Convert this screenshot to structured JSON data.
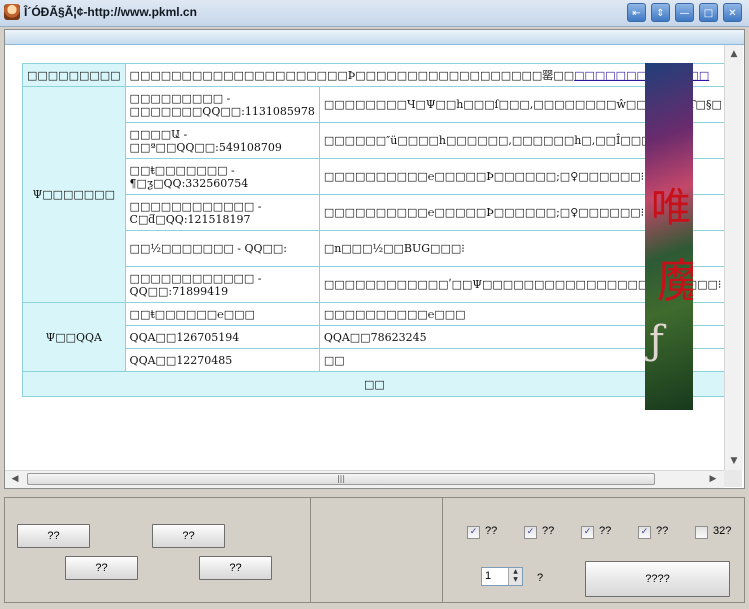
{
  "window": {
    "title": "Î´ÓÐÃ§Ã¦¢-http://www.pkml.cn"
  },
  "table": {
    "row1": {
      "label": "□□□□□□□□□",
      "text": "□□□□□□□□□□□□□□□□□□□□□Þ□□□□□□□□□□□□□□□□□□罂□□",
      "link": "□□□□□□□□□□□□□"
    },
    "group1_label": "Ψ□□□□□□□",
    "staff": [
      {
        "name": "□□□□□□□□□ -\n□□□□□□□QQ□□:1131085978",
        "desc": "□□□□□□□□Ч□Ψ□□h□□□ſ□□□,□□□□□□□□ŵ□□□□□□Т□§□"
      },
      {
        "name": "□□□□Ա -\n□□ª□□QQ□□:549108709",
        "desc": "□□□□□□″ü□□□□h□□□□□□,□□□□□□h□,□□Î□□□ḉ□"
      },
      {
        "name": "□□ŧ□□□□□□□ -\n¶□ƺ□QQ:332560754",
        "desc": "□□□□□□□□□□℮□□□□□Þ□□□□□□;□♀□□□□□□⁝"
      },
      {
        "name": "□□□□□□□□□□□□ -\nC□ƌ□QQ:121518197",
        "desc": "□□□□□□□□□□℮□□□□□Þ□□□□□□;□♀□□□□□□⁝"
      },
      {
        "name": "□□½□□□□□□□ - QQ□□:",
        "desc": "□n□□□½□□BUG□□□⁝"
      },
      {
        "name": "□□□□□□□□□□□□ -\nQQ□□:71899419",
        "desc": "□□□□□□□□□□□□ʹ□□Ψ□□□□□□□□□□□□□□□□□π□□□□□⁝"
      }
    ],
    "group2_label": "Ψ□□QQA",
    "qq_rows": [
      {
        "left": "□□ŧ□□□□□□℮□□□",
        "right": "□□□□□□□□□□℮□□□"
      },
      {
        "left": "QQA□□126705194",
        "right": "QQA□□78623245"
      },
      {
        "left": "QQA□□12270485",
        "right": "□□"
      }
    ],
    "footer": "□□"
  },
  "banner": {
    "line1": "唯",
    "line2": "魔",
    "line3": "ƒ"
  },
  "left_buttons": [
    "??",
    "??",
    "??",
    "??"
  ],
  "checkboxes": [
    {
      "label": "??",
      "checked": true
    },
    {
      "label": "??",
      "checked": true
    },
    {
      "label": "??",
      "checked": true
    },
    {
      "label": "??",
      "checked": true
    },
    {
      "label": "32?",
      "checked": false
    }
  ],
  "spinner": {
    "value": "1",
    "label": "?"
  },
  "start_button": "????"
}
